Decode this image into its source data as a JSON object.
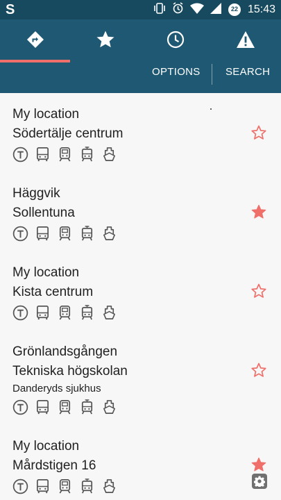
{
  "status_bar": {
    "app_letter": "S",
    "time": "15:43",
    "notification_count": "22",
    "icons": [
      "vibrate-icon",
      "alarm-icon",
      "wifi-icon",
      "signal-icon",
      "battery-icon"
    ]
  },
  "tabs": [
    {
      "icon": "directions-icon",
      "active": true
    },
    {
      "icon": "star-icon",
      "active": false
    },
    {
      "icon": "clock-icon",
      "active": false
    },
    {
      "icon": "warning-icon",
      "active": false
    }
  ],
  "actions": {
    "options_label": "OPTIONS",
    "search_label": "SEARCH"
  },
  "colors": {
    "status_bar": "#17495f",
    "header": "#1e5872",
    "accent": "#ef6f6a",
    "text": "#212121",
    "icon_gray": "#555555"
  },
  "trips": [
    {
      "from": "My location",
      "to": "Södertälje centrum",
      "via": "",
      "starred": false
    },
    {
      "from": "Häggvik",
      "to": "Sollentuna",
      "via": "",
      "starred": true
    },
    {
      "from": "My location",
      "to": "Kista centrum",
      "via": "",
      "starred": false
    },
    {
      "from": "Grönlandsgången",
      "to": "Tekniska högskolan",
      "via": "Danderyds sjukhus",
      "starred": false
    },
    {
      "from": "My location",
      "to": "Mårdstigen 16",
      "via": "",
      "starred": true
    }
  ],
  "transport_modes": [
    "metro-icon",
    "bus-icon",
    "commuter-train-icon",
    "tram-icon",
    "ferry-icon"
  ]
}
